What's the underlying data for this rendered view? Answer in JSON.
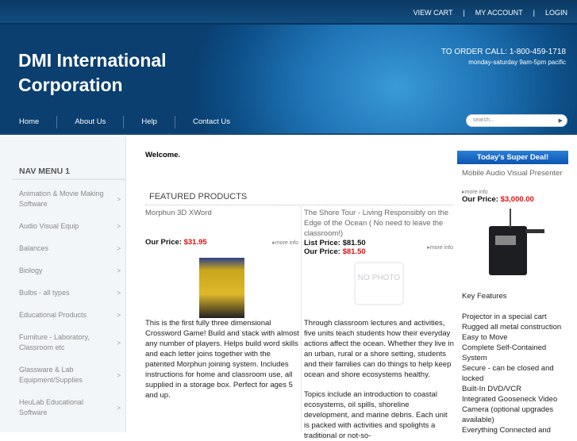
{
  "top_links": [
    "VIEW CART",
    "|",
    "MY ACCOUNT",
    "|",
    "LOGIN"
  ],
  "logo": "DMI International Corporation",
  "order": {
    "call": "TO ORDER CALL: 1-800-459-1718",
    "hours": "monday-saturday 9am-5pm pacific"
  },
  "main_nav": [
    "Home",
    "About Us",
    "Help",
    "Contact Us"
  ],
  "search": {
    "placeholder": "search..."
  },
  "sidebar": {
    "title": "NAV MENU 1",
    "items": [
      "Animation & Movie Making Software",
      "Audio Visual Equip",
      "Balances",
      "Biology",
      "Bulbs - all types",
      "Educational Products",
      "Furniture - Laboratory, Classroom etc",
      "Glassware & Lab Equipment/Supplies",
      "HeuLab Educational Software"
    ]
  },
  "welcome": "Welcome.",
  "featured": {
    "title": "FEATURED PRODUCTS",
    "products": [
      {
        "name": "Morphun 3D XWord",
        "our_price_label": "Our Price:",
        "our_price": "$31.95",
        "more": "more info",
        "desc": "This is the first fully three dimensional Crossword Game! Build and stack with almost any number of players. Helps build word skills and each letter joins together with the patented Morphun joining system. Includes instructions for home and classroom use, all supplied in a storage box. Perfect for ages 5 and up."
      },
      {
        "name": "The Shore Tour - Living Responsibly on the Edge of the Ocean ( No need to leave the classroom!)",
        "list_price_label": "List Price:",
        "list_price": "$81.50",
        "our_price_label": "Our Price:",
        "our_price": "$81.50",
        "more": "more info",
        "no_photo": "NO PHOTO",
        "desc": "Through classroom lectures and activities, five units teach students how their everyday actions affect the ocean. Whether they live in an urban, rural or a shore setting, students and their families can do things to help keep ocean and shore ecosystems healthy.",
        "desc2": "Topics include an introduction to coastal ecosystems, oil spills, shoreline development, and marine debris. Each unit is packed with activities and spolights a traditional or not-so-"
      }
    ]
  },
  "deal": {
    "title": "Today's Super Deal!",
    "name": "Mobile Audio Visual Presenter",
    "more": "more info",
    "our_price_label": "Our Price:",
    "our_price": "$3,000.00",
    "features_title": "Key Features",
    "features": [
      "Projector in a special cart",
      "Rugged all metal construction",
      "Easy to Move",
      "Complete Self-Contained System",
      "Secure - can be closed and locked",
      "Built-In DVD/VCR",
      "Integrated Gooseneck Video Camera (optional upgrades available)",
      "Everything Connected and"
    ]
  }
}
